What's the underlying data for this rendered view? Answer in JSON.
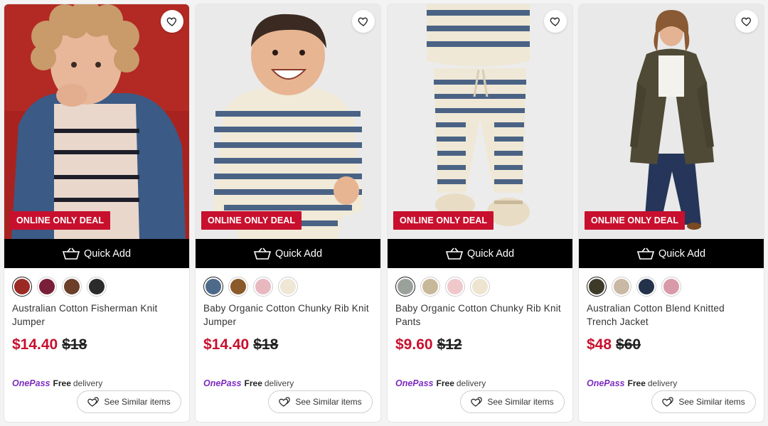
{
  "products": [
    {
      "name": "Australian Cotton Fisherman Knit Jumper",
      "price_now": "$14.40",
      "price_was": "$18",
      "badge": "ONLINE ONLY DEAL",
      "quick_add": "Quick Add",
      "onepass_brand": "OnePass",
      "free": "Free",
      "delivery": "delivery",
      "similar": "See Similar items",
      "swatch_colors": [
        "#9b2a24",
        "#7a1f3a",
        "#6b3f2a",
        "#2b2b2b"
      ]
    },
    {
      "name": "Baby Organic Cotton Chunky Rib Knit Jumper",
      "price_now": "$14.40",
      "price_was": "$18",
      "badge": "ONLINE ONLY DEAL",
      "quick_add": "Quick Add",
      "onepass_brand": "OnePass",
      "free": "Free",
      "delivery": "delivery",
      "similar": "See Similar items",
      "swatch_colors": [
        "#4d6a8a",
        "#8a5a2a",
        "#e8b8c0",
        "#efe6d6"
      ]
    },
    {
      "name": "Baby Organic Cotton Chunky Rib Knit Pants",
      "price_now": "$9.60",
      "price_was": "$12",
      "badge": "ONLINE ONLY DEAL",
      "quick_add": "Quick Add",
      "onepass_brand": "OnePass",
      "free": "Free",
      "delivery": "delivery",
      "similar": "See Similar items",
      "swatch_colors": [
        "#9aa09a",
        "#c8b89a",
        "#f0c8cc",
        "#efe4cf"
      ]
    },
    {
      "name": "Australian Cotton Blend Knitted Trench Jacket",
      "price_now": "$48",
      "price_was": "$60",
      "badge": "ONLINE ONLY DEAL",
      "quick_add": "Quick Add",
      "onepass_brand": "OnePass",
      "free": "Free",
      "delivery": "delivery",
      "similar": "See Similar items",
      "swatch_colors": [
        "#3d3a2a",
        "#c9b9a4",
        "#23324a",
        "#d89aa8"
      ]
    }
  ],
  "icons": {
    "favourite": "heart-icon",
    "quick_add": "basket-icon",
    "similar": "similar-hearts-icon"
  },
  "colors": {
    "deal_red": "#c8102e",
    "price_red": "#c8102e",
    "onepass_purple": "#7b2cbf",
    "quick_add_bg": "#000000"
  }
}
